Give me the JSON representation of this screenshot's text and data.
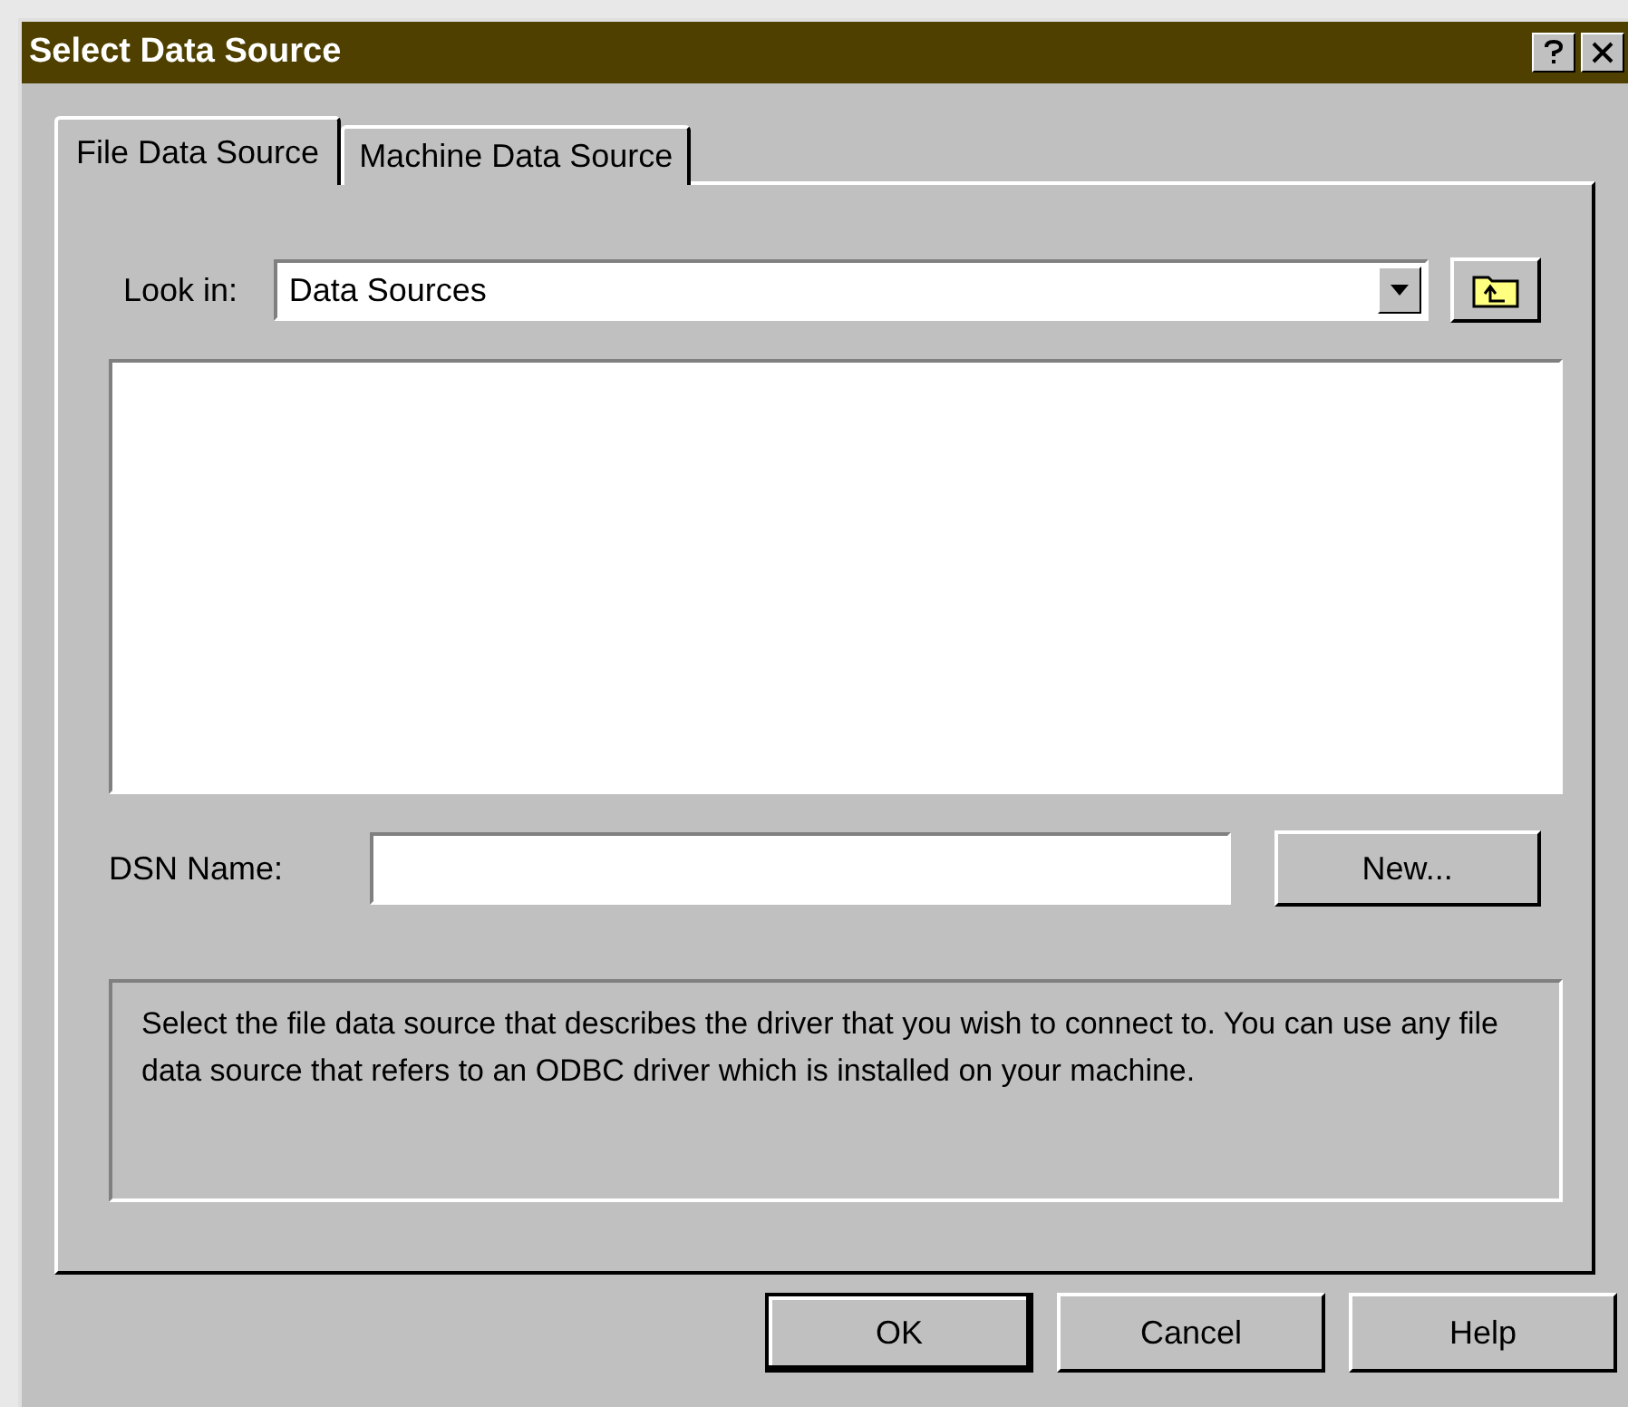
{
  "window": {
    "title": "Select Data Source"
  },
  "tabs": [
    {
      "label": "File Data Source",
      "selected": true
    },
    {
      "label": "Machine Data Source",
      "selected": false
    }
  ],
  "look_in": {
    "label": "Look in:",
    "value": "Data Sources"
  },
  "dsn_name": {
    "label": "DSN Name:"
  },
  "new_button": "New...",
  "description": "Select the file data source that describes the driver that you wish to connect to. You can use any file data source that refers to an ODBC driver which is installed on your machine.",
  "buttons": [
    {
      "label": "OK",
      "default": true
    },
    {
      "label": "Cancel",
      "default": false
    },
    {
      "label": "Help",
      "default": false
    }
  ]
}
